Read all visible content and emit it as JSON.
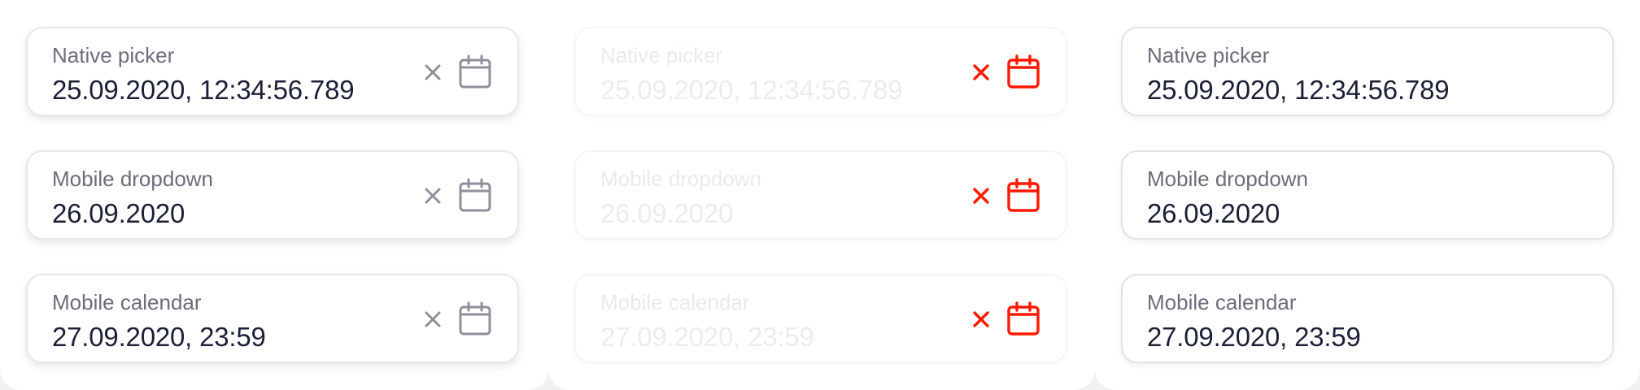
{
  "colors": {
    "icon_default": "#8e909b",
    "icon_error": "#ff1a00",
    "text_value": "#1c2036",
    "text_label": "#6b6e7a"
  },
  "columns": [
    {
      "state": "default",
      "fields": [
        {
          "label": "Native picker",
          "value": "25.09.2020, 12:34:56.789",
          "clear_icon": "close-icon",
          "calendar_icon": "calendar-icon"
        },
        {
          "label": "Mobile dropdown",
          "value": "26.09.2020",
          "clear_icon": "close-icon",
          "calendar_icon": "calendar-icon"
        },
        {
          "label": "Mobile calendar",
          "value": "27.09.2020, 23:59",
          "clear_icon": "close-icon",
          "calendar_icon": "calendar-icon"
        }
      ]
    },
    {
      "state": "disabled-invalid",
      "fields": [
        {
          "label": "Native picker",
          "value": "25.09.2020, 12:34:56.789",
          "clear_icon": "close-icon",
          "calendar_icon": "calendar-icon"
        },
        {
          "label": "Mobile dropdown",
          "value": "26.09.2020",
          "clear_icon": "close-icon",
          "calendar_icon": "calendar-icon"
        },
        {
          "label": "Mobile calendar",
          "value": "27.09.2020, 23:59",
          "clear_icon": "close-icon",
          "calendar_icon": "calendar-icon"
        }
      ]
    },
    {
      "state": "readonly",
      "fields": [
        {
          "label": "Native picker",
          "value": "25.09.2020, 12:34:56.789"
        },
        {
          "label": "Mobile dropdown",
          "value": "26.09.2020"
        },
        {
          "label": "Mobile calendar",
          "value": "27.09.2020, 23:59"
        }
      ]
    }
  ]
}
